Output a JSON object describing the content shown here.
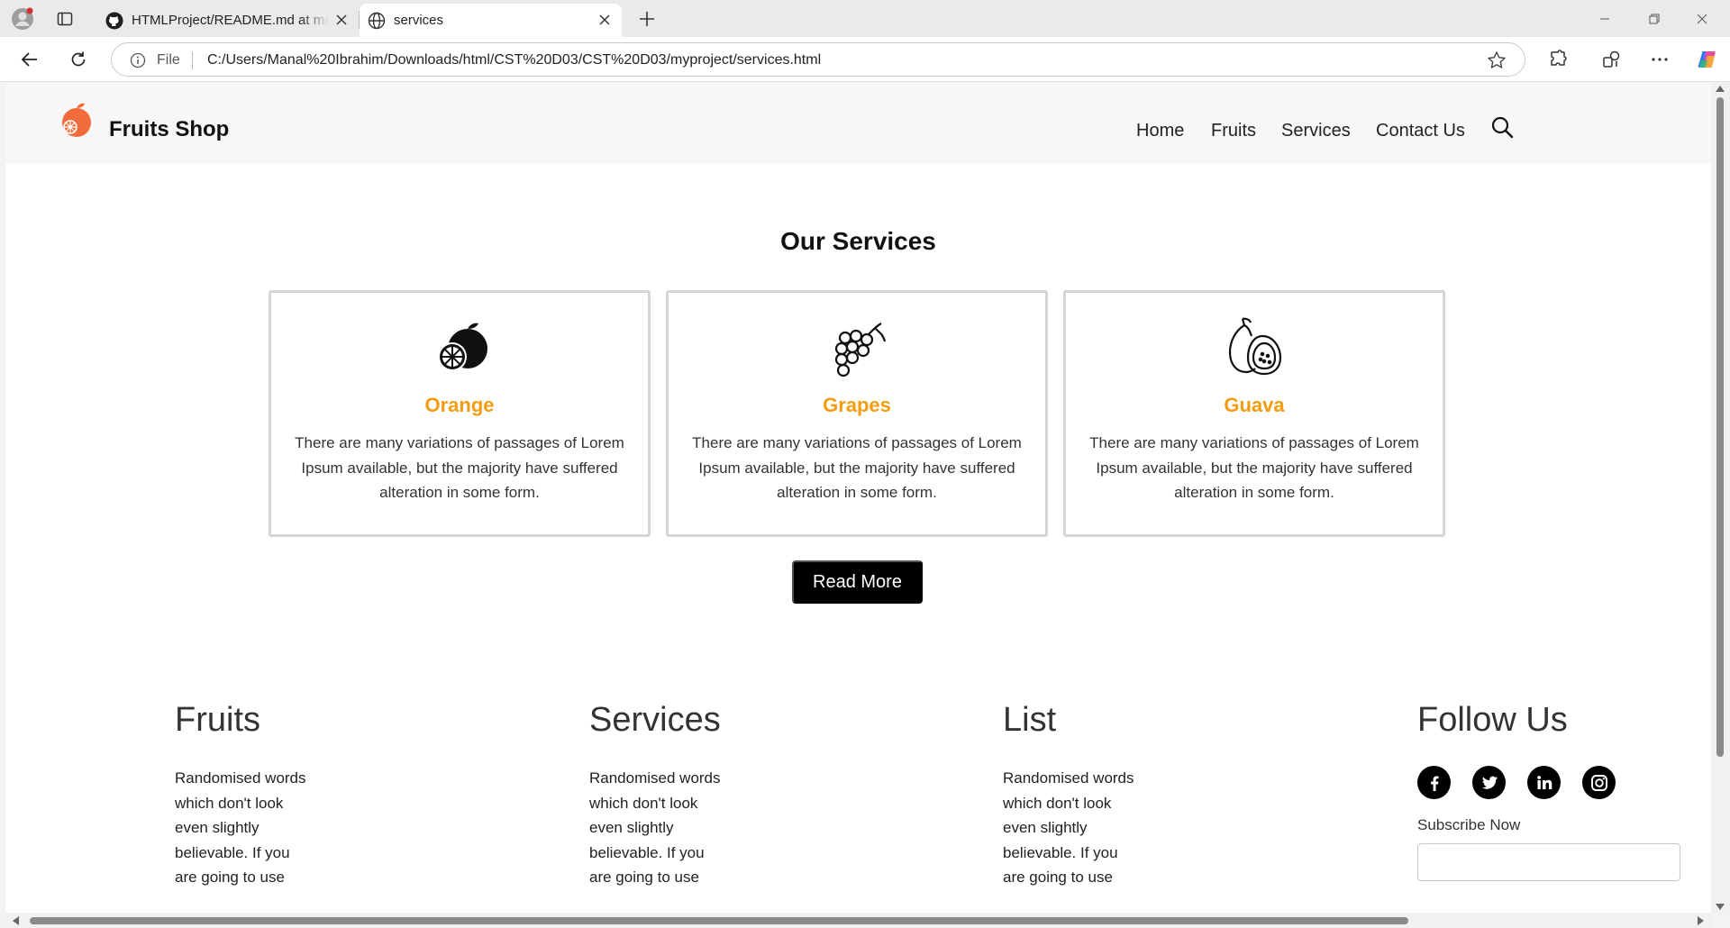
{
  "browser": {
    "tabs": [
      {
        "title": "HTMLProject/README.md at main",
        "favicon": "github-icon"
      },
      {
        "title": "services",
        "favicon": "globe-icon"
      }
    ],
    "address": {
      "scheme": "File",
      "url": "C:/Users/Manal%20Ibrahim/Downloads/html/CST%20D03/CST%20D03/myproject/services.html"
    }
  },
  "site": {
    "brand": "Fruits Shop",
    "logo_color": "#f26b3a",
    "nav": [
      "Home",
      "Fruits",
      "Services",
      "Contact Us"
    ],
    "accent": "#f39c12"
  },
  "services": {
    "title": "Our Services",
    "cards": [
      {
        "name": "Orange",
        "icon": "orange-icon",
        "text": "There are many variations of passages of Lorem Ipsum available, but the majority have suffered alteration in some form."
      },
      {
        "name": "Grapes",
        "icon": "grapes-icon",
        "text": "There are many variations of passages of Lorem Ipsum available, but the majority have suffered alteration in some form."
      },
      {
        "name": "Guava",
        "icon": "guava-icon",
        "text": "There are many variations of passages of Lorem Ipsum available, but the majority have suffered alteration in some form."
      }
    ],
    "button": "Read More"
  },
  "footer": {
    "columns": [
      {
        "heading": "Fruits",
        "text": "Randomised words which don't look even slightly believable. If you are going to use"
      },
      {
        "heading": "Services",
        "text": "Randomised words which don't look even slightly believable. If you are going to use"
      },
      {
        "heading": "List",
        "text": "Randomised words which don't look even slightly believable. If you are going to use"
      }
    ],
    "follow": {
      "heading": "Follow Us",
      "icons": [
        "facebook-icon",
        "twitter-icon",
        "linkedin-icon",
        "instagram-icon"
      ],
      "subscribe_label": "Subscribe Now",
      "subscribe_value": ""
    }
  }
}
